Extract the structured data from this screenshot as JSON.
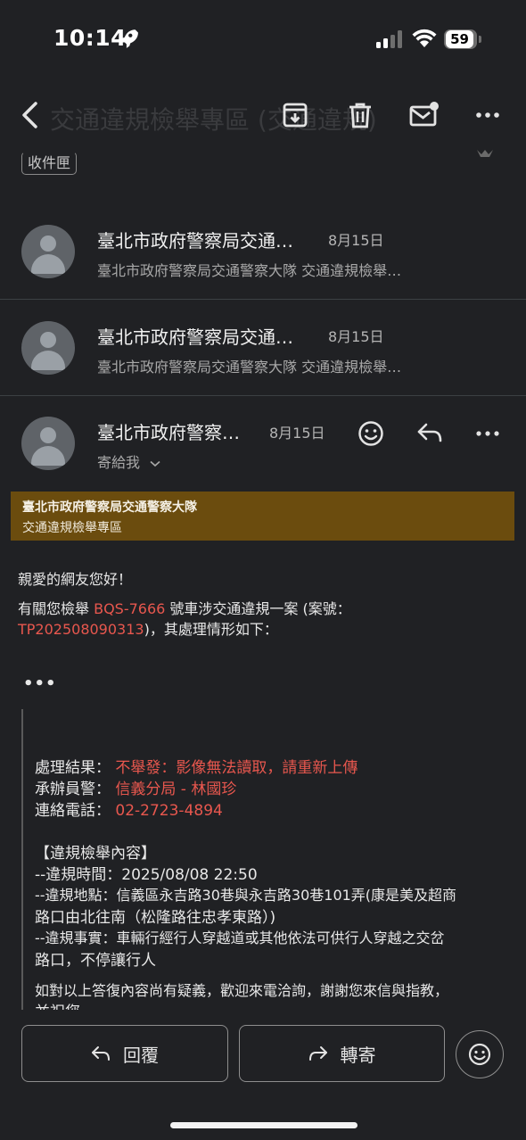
{
  "status_bar": {
    "time": "10:14",
    "battery": "59"
  },
  "toolbar": {
    "faded_subject": "交通違規檢舉專區 (交通違規)"
  },
  "label_chip": "收件匣",
  "threads": [
    {
      "sender": "臺北市政府警察局交通…",
      "date": "8月15日",
      "snippet": "臺北市政府警察局交通警察大隊 交通違規檢舉…"
    },
    {
      "sender": "臺北市政府警察局交通…",
      "date": "8月15日",
      "snippet": "臺北市政府警察局交通警察大隊 交通違規檢舉…"
    }
  ],
  "open_message": {
    "sender": "臺北市政府警察…",
    "date": "8月15日",
    "to_me": "寄給我"
  },
  "banner": {
    "title": "臺北市政府警察局交通警察大隊",
    "subtitle": "交通違規檢舉專區"
  },
  "body": {
    "greeting": "親愛的網友您好！",
    "line1_a": "有關您檢舉",
    "plate": "BQS-7666",
    "line1_b": "號車涉交通違規一案 (案號：",
    "case_no": "TP202508090313",
    "line2_b": ")，其處理情形如下：",
    "ellipsis": "•••",
    "result_label": "處理結果：",
    "result_value": "不舉發：影像無法讀取，請重新上傳",
    "officer_label": "承辦員警：",
    "officer_value": "信義分局 - 林國珍",
    "phone_label": "連絡電話：",
    "phone_value": "02-2723-4894",
    "section_title": "【違規檢舉內容】",
    "time_line": "--違規時間：2025/08/08 22:50",
    "place_line1": "--違規地點：信義區永吉路30巷與永吉路30巷101弄(康是美及超商",
    "place_line2": "路口由北往南（松隆路往忠孝東路）)",
    "fact_line1": "--違規事實：車輛行經行人穿越道或其他依法可供行人穿越之交岔",
    "fact_line2": "路口，不停讓行人",
    "closing_line1": "如對以上答復內容尚有疑義，歡迎來電洽詢，謝謝您來信與指教，",
    "closing_line2": "並祝您"
  },
  "actions": {
    "reply": "回覆",
    "forward": "轉寄"
  }
}
